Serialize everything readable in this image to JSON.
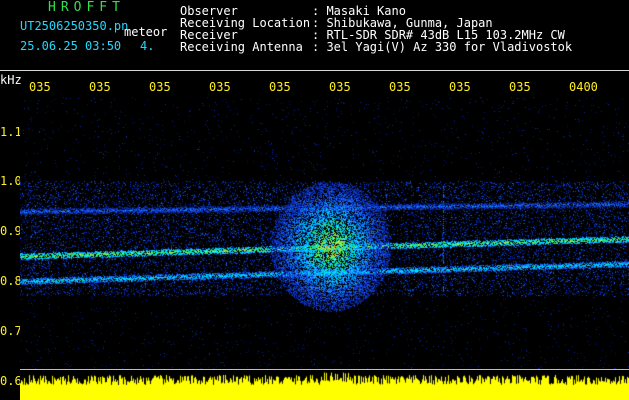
{
  "header": {
    "title": "HROFFT",
    "filename": "UT2506250350.pn",
    "tag": "meteor",
    "datetime": "25.06.25 03:50",
    "count": "4.",
    "observer_label": "Observer",
    "observer_value": ": Masaki Kano",
    "location_label": "Receiving Location",
    "location_value": ": Shibukawa, Gunma, Japan",
    "receiver_label": "Receiver",
    "receiver_value": ": RTL-SDR SDR# 43dB L15 103.2MHz CW",
    "antenna_label": "Receiving Antenna",
    "antenna_value": ": 3el Yagi(V) Az 330 for Vladivostok"
  },
  "axis": {
    "unit": "kHz",
    "time_labels": [
      "035",
      "035",
      "035",
      "035",
      "035",
      "035",
      "035",
      "035",
      "035",
      "0400"
    ],
    "freq_labels": [
      "1.1",
      "1.0",
      "0.9",
      "0.8",
      "0.7",
      "0.6"
    ]
  },
  "chart_data": {
    "type": "heatmap",
    "ylabel": "kHz",
    "ylim": [
      0.6,
      1.1
    ],
    "x_ticks": [
      "035",
      "035",
      "035",
      "035",
      "035",
      "035",
      "035",
      "035",
      "035",
      "0400"
    ],
    "y_ticks": [
      1.1,
      1.0,
      0.9,
      0.8,
      0.7,
      0.6
    ],
    "traces": [
      {
        "freq_start": 0.85,
        "freq_end": 0.885,
        "intensity": "high"
      },
      {
        "freq_start": 0.8,
        "freq_end": 0.835,
        "intensity": "medium"
      },
      {
        "freq_start": 0.94,
        "freq_end": 0.955,
        "intensity": "low"
      }
    ],
    "meteor_echo": {
      "time_fraction": 0.51,
      "freq_center": 0.87,
      "freq_top": 1.04,
      "freq_bottom": 0.78
    },
    "colors": {
      "background": "#000000",
      "noise": "#0a2aa8",
      "mid": "#00c8ff",
      "high": "#2ee060",
      "peak": "#ff2020",
      "amplitude": "#ffff00"
    }
  }
}
